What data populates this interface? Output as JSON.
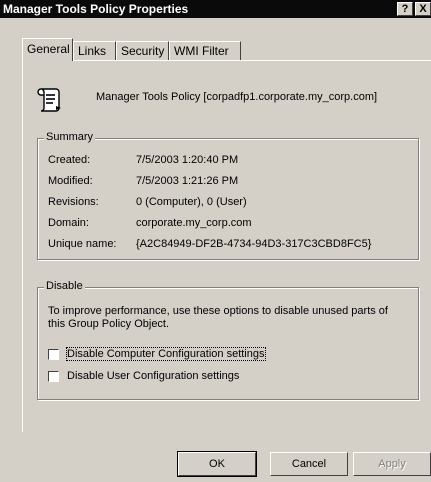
{
  "window": {
    "title": "Manager Tools Policy Properties",
    "help_label": "?",
    "close_label": "X"
  },
  "tabs": [
    {
      "label": "General"
    },
    {
      "label": "Links"
    },
    {
      "label": "Security"
    },
    {
      "label": "WMI Filter"
    }
  ],
  "policy": {
    "name": "Manager Tools Policy [corpadfp1.corporate.my_corp.com]"
  },
  "summary": {
    "legend": "Summary",
    "rows": [
      {
        "label": "Created:",
        "value": "7/5/2003 1:20:40 PM"
      },
      {
        "label": "Modified:",
        "value": "7/5/2003 1:21:26 PM"
      },
      {
        "label": "Revisions:",
        "value": "0 (Computer), 0 (User)"
      },
      {
        "label": "Domain:",
        "value": "corporate.my_corp.com"
      },
      {
        "label": "Unique name:",
        "value": "{A2C84949-DF2B-4734-94D3-317C3CBD8FC5}"
      }
    ]
  },
  "disable": {
    "legend": "Disable",
    "description": "To improve performance, use these options to disable unused parts of this Group Policy Object.",
    "options": [
      {
        "label": "Disable Computer Configuration settings",
        "checked": false
      },
      {
        "label": "Disable User Configuration settings",
        "checked": false
      }
    ]
  },
  "buttons": {
    "ok": "OK",
    "cancel": "Cancel",
    "apply": "Apply"
  }
}
